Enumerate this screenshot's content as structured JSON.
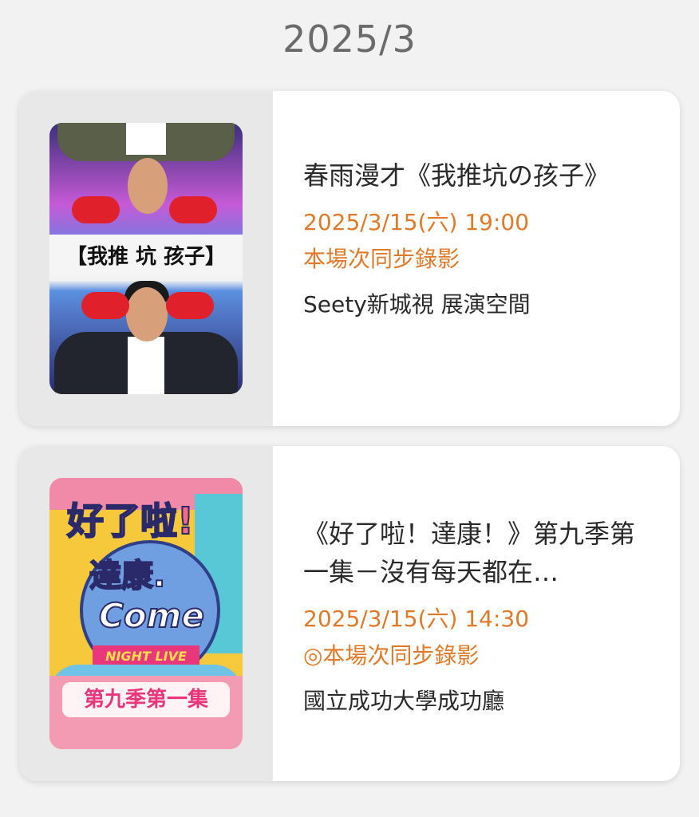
{
  "header": {
    "month": "2025/3"
  },
  "events": [
    {
      "title": "春雨漫才《我推坑の孩子》",
      "datetime": "2025/3/15(六) 19:00",
      "note": "本場次同步錄影",
      "venue": "Seety新城視 展演空間",
      "poster": {
        "text": "【我推 坑 孩子】",
        "icon": "comedy-poster-image"
      }
    },
    {
      "title": "《好了啦！達康！》第九季第一集－沒有每天都在…",
      "datetime": "2025/3/15(六) 14:30",
      "note": "◎本場次同步錄影",
      "venue": "國立成功大學成功廳",
      "poster": {
        "line1": "好了啦!",
        "line2": "達康.",
        "line3": "Come",
        "tag": "NIGHT LIVE",
        "season": "第九季第一集",
        "icon": "show-poster-image"
      }
    }
  ],
  "colors": {
    "accent": "#e07a2a",
    "text": "#2a2a2a",
    "muted": "#6b6b6b"
  }
}
